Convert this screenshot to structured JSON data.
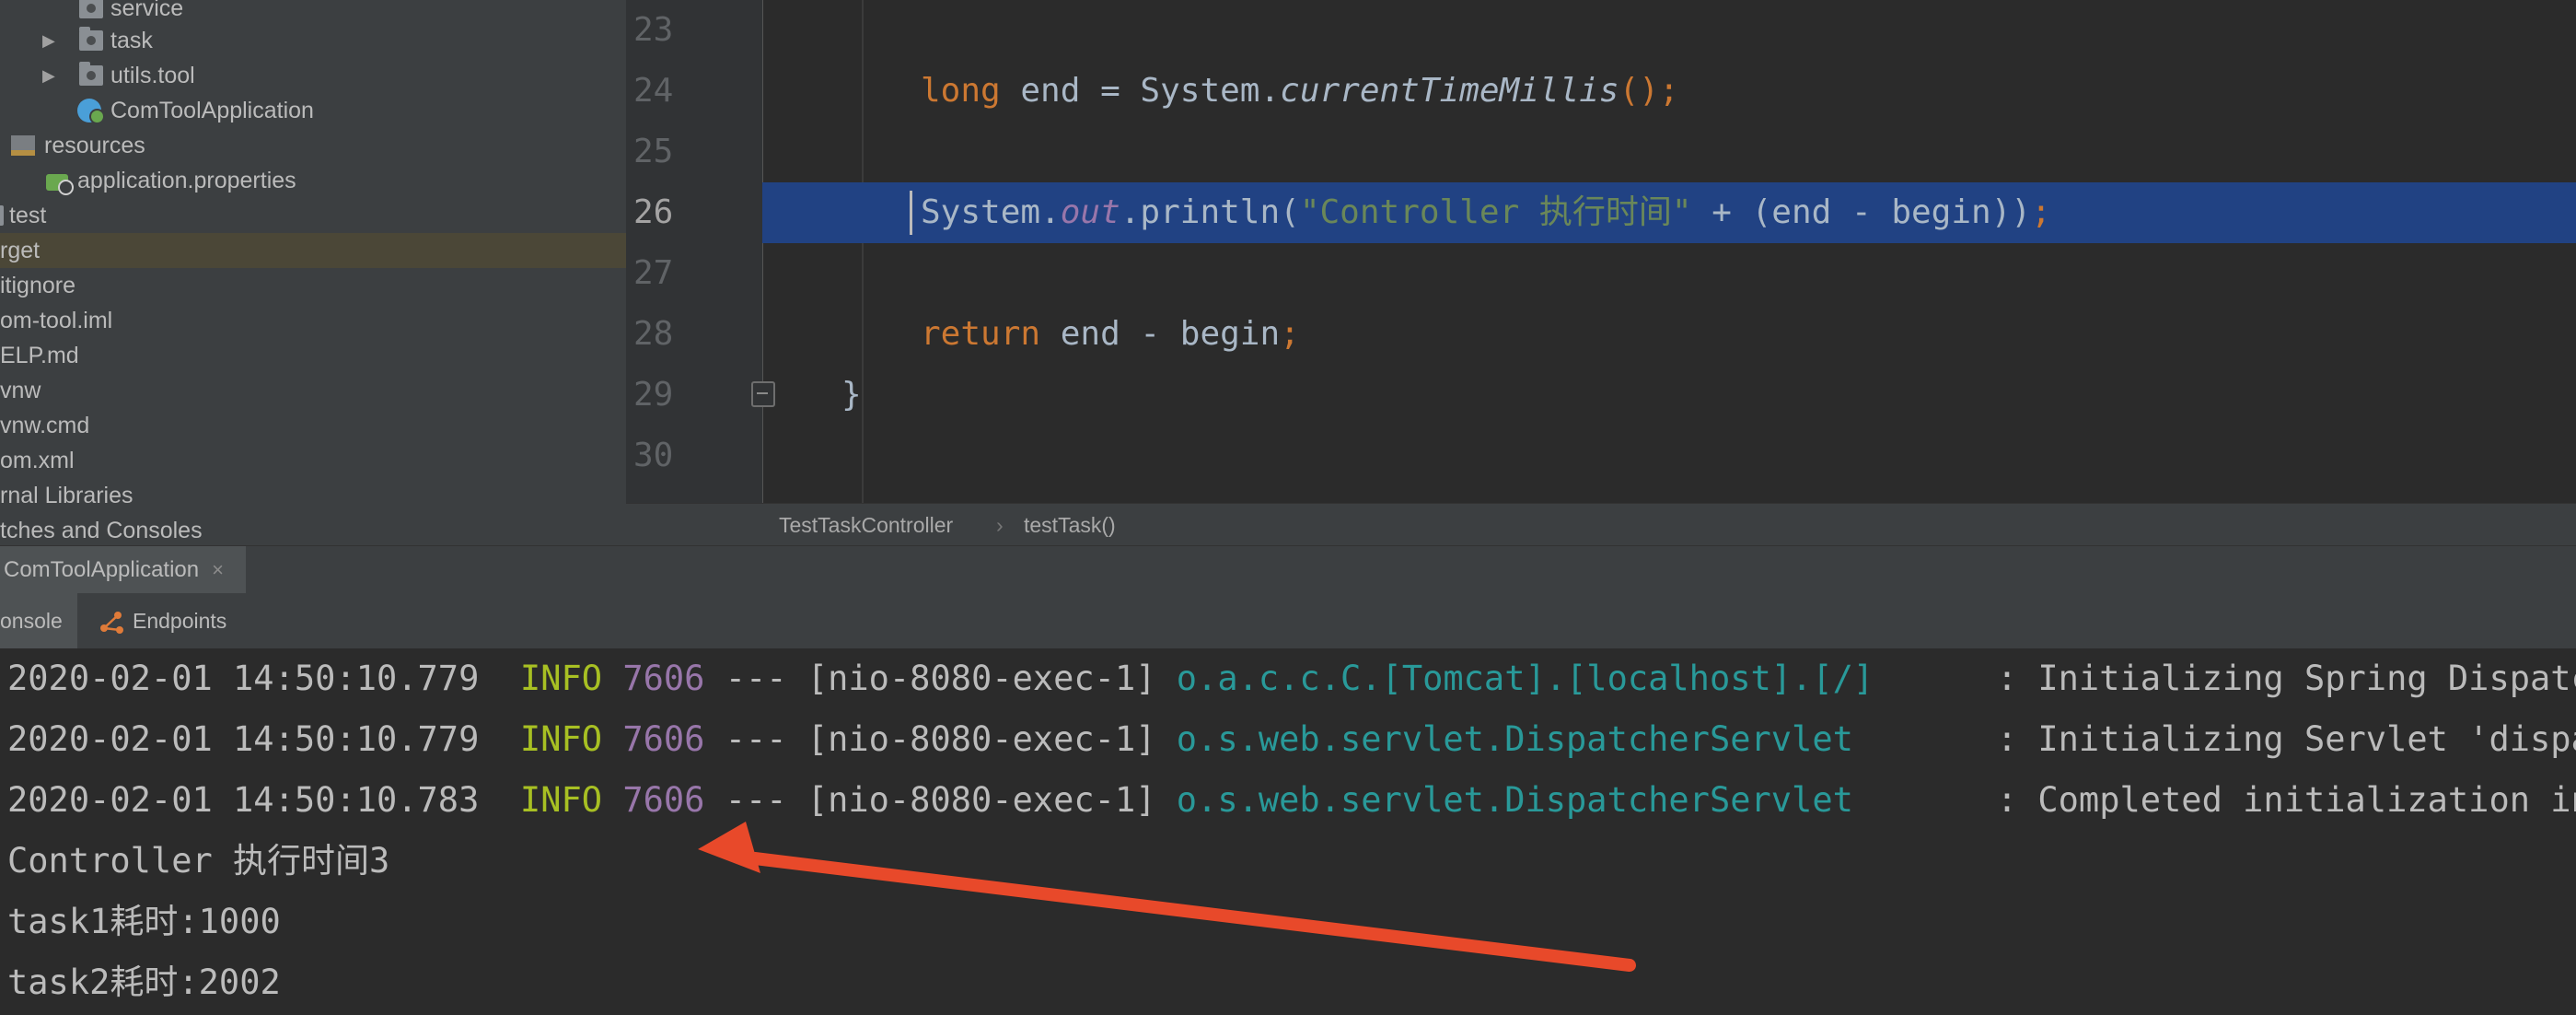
{
  "project_tree": {
    "items": [
      {
        "label": "service"
      },
      {
        "label": "task"
      },
      {
        "label": "utils.tool"
      },
      {
        "label": "ComToolApplication"
      },
      {
        "label": "resources"
      },
      {
        "label": "application.properties"
      },
      {
        "label": "test"
      },
      {
        "label": "rget"
      },
      {
        "label": "itignore"
      },
      {
        "label": "om-tool.iml"
      },
      {
        "label": "ELP.md"
      },
      {
        "label": "vnw"
      },
      {
        "label": "vnw.cmd"
      },
      {
        "label": "om.xml"
      },
      {
        "label": "rnal Libraries"
      },
      {
        "label": "tches and Consoles"
      }
    ],
    "selected": "rget"
  },
  "editor": {
    "line_numbers": [
      "23",
      "24",
      "25",
      "26",
      "27",
      "28",
      "29",
      "30"
    ],
    "current_line": "26",
    "line24": {
      "kw": "long",
      "mid": " end = System.",
      "call": "currentTimeMillis",
      "end": "();"
    },
    "line26": {
      "pre": "System.",
      "field": "out",
      "mid": ".println(",
      "str": "\"Controller 执行时间\"",
      "rest": " + (end - begin))",
      "semi": ";"
    },
    "line28": {
      "kw": "return",
      "mid": " end - begin",
      "semi": ";"
    },
    "line29": {
      "brace": "}"
    },
    "breadcrumb": {
      "class": "TestTaskController",
      "sep": "›",
      "method": "testTask()"
    }
  },
  "run_panel": {
    "tab_label": "ComToolApplication",
    "close_glyph": "×",
    "subtabs": [
      "onsole",
      "Endpoints"
    ],
    "log_lines": [
      {
        "ts": "2020-02-01 14:50:10.779",
        "level": "INFO",
        "pid": "7606",
        "thread": "--- [nio-8080-exec-1]",
        "logger": "o.a.c.c.C.[Tomcat].[localhost].[/]",
        "msg": ": Initializing Spring Dispatc"
      },
      {
        "ts": "2020-02-01 14:50:10.779",
        "level": "INFO",
        "pid": "7606",
        "thread": "--- [nio-8080-exec-1]",
        "logger": "o.s.web.servlet.DispatcherServlet",
        "msg": ": Initializing Servlet 'dispa"
      },
      {
        "ts": "2020-02-01 14:50:10.783",
        "level": "INFO",
        "pid": "7606",
        "thread": "--- [nio-8080-exec-1]",
        "logger": "o.s.web.servlet.DispatcherServlet",
        "msg": ": Completed initialization in"
      }
    ],
    "output_lines": [
      "Controller 执行时间3",
      "task1耗时:1000",
      "task2耗时:2002"
    ]
  },
  "annotation": {
    "arrow_color": "#e8492a"
  }
}
